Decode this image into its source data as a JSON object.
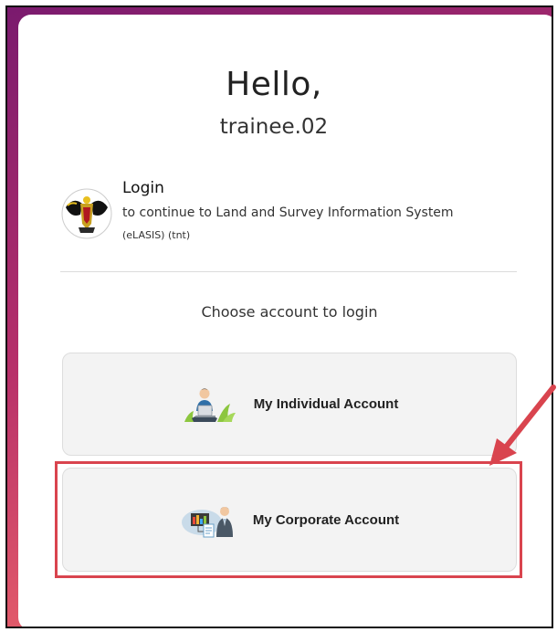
{
  "greeting": {
    "hello": "Hello,",
    "username": "trainee.02"
  },
  "login": {
    "title": "Login",
    "subtitle": "to continue to Land and Survey Information System",
    "subtitle_extra": "(eLASIS) (tnt)",
    "logo_icon": "state-crest-icon"
  },
  "choose_prompt": "Choose account to login",
  "accounts": [
    {
      "label": "My Individual Account",
      "icon": "person-laptop-icon"
    },
    {
      "label": "My Corporate Account",
      "icon": "business-person-icon"
    }
  ],
  "colors": {
    "highlight": "#d9444e",
    "button_bg": "#f3f3f3",
    "frame_gradient_start": "#7a1a6e",
    "frame_gradient_end": "#f08a62"
  }
}
